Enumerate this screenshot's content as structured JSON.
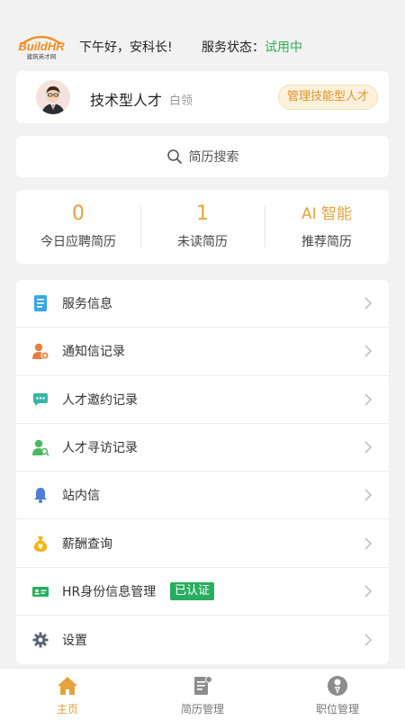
{
  "header": {
    "logo_text": "BuildHR",
    "logo_subtext": "建筑英才网",
    "greeting": "下午好，安科长!",
    "service_status_label": "服务状态：",
    "service_status_value": "试用中"
  },
  "profile": {
    "name": "技术型人才",
    "tag": "白领",
    "action_label": "管理技能型人才"
  },
  "search": {
    "placeholder": "简历搜索"
  },
  "stats": [
    {
      "value": "0",
      "label": "今日应聘简历"
    },
    {
      "value": "1",
      "label": "未读简历"
    },
    {
      "value": "AI 智能",
      "label": "推荐简历"
    }
  ],
  "menu": [
    {
      "label": "服务信息",
      "icon": "document-icon"
    },
    {
      "label": "通知信记录",
      "icon": "user-notice-icon"
    },
    {
      "label": "人才邀约记录",
      "icon": "chat-icon"
    },
    {
      "label": "人才寻访记录",
      "icon": "user-search-icon"
    },
    {
      "label": "站内信",
      "icon": "bell-icon"
    },
    {
      "label": "薪酬查询",
      "icon": "money-bag-icon"
    },
    {
      "label": "HR身份信息管理",
      "icon": "id-card-icon",
      "badge": "已认证"
    },
    {
      "label": "设置",
      "icon": "gear-icon"
    }
  ],
  "tabs": [
    {
      "label": "主页",
      "icon": "home-icon",
      "active": true
    },
    {
      "label": "简历管理",
      "icon": "resume-icon",
      "active": false
    },
    {
      "label": "职位管理",
      "icon": "position-icon",
      "active": false
    }
  ],
  "colors": {
    "accent": "#e6a23c",
    "status_green": "#2fae52",
    "badge_green": "#27ae5f",
    "background": "#f2f2f2"
  }
}
